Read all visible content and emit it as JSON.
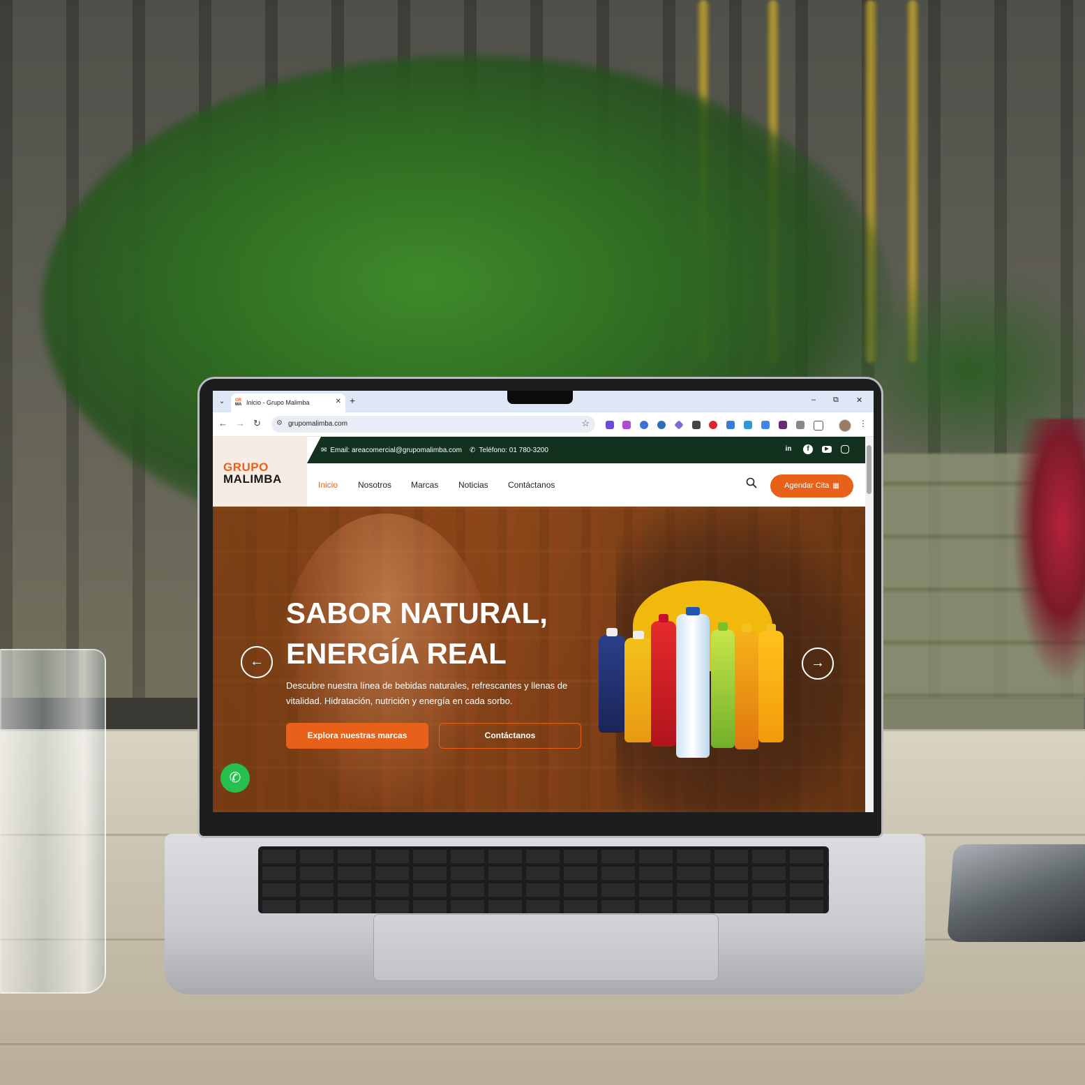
{
  "browser": {
    "tab": {
      "favicon_top": "GR",
      "favicon_bottom": "MA",
      "title": "Inicio - Grupo Malimba"
    },
    "new_tab_icon": "plus-icon",
    "window_controls": {
      "minimize": "–",
      "restore": "⧉",
      "close": "✕"
    },
    "url": "grupomalimba.com",
    "extensions": [
      "home-extension",
      "purple-extension",
      "audio-extension",
      "wordpress-extension",
      "diamond-extension",
      "download-extension",
      "opera-extension",
      "wifi-extension",
      "feather-extension",
      "tag-extension",
      "dark-extension",
      "grey-extension",
      "puzzle-extension"
    ]
  },
  "site": {
    "logo": {
      "line1": "GRUPO",
      "line2": "MALIMBA"
    },
    "topbar": {
      "email": "Email: areacomercial@grupomalimba.com",
      "phone": "Teléfono: 01 780-3200",
      "social": [
        "linkedin-icon",
        "facebook-icon",
        "youtube-icon",
        "instagram-icon"
      ]
    },
    "nav": {
      "items": [
        "Inicio",
        "Nosotros",
        "Marcas",
        "Noticias",
        "Contáctanos"
      ],
      "active": "Inicio",
      "cta": "Agendar Cita"
    },
    "hero": {
      "title_line1": "SABOR NATURAL,",
      "title_line2": "ENERGÍA REAL",
      "text": "Descubre nuestra línea de bebidas naturales, refrescantes y llenas de vitalidad. Hidratación, nutrición y energía en cada sorbo.",
      "primary_button": "Explora nuestras marcas",
      "secondary_button": "Contáctanos"
    }
  },
  "colors": {
    "accent": "#e8611a",
    "topbar": "#12311f",
    "whatsapp": "#27c04c"
  }
}
